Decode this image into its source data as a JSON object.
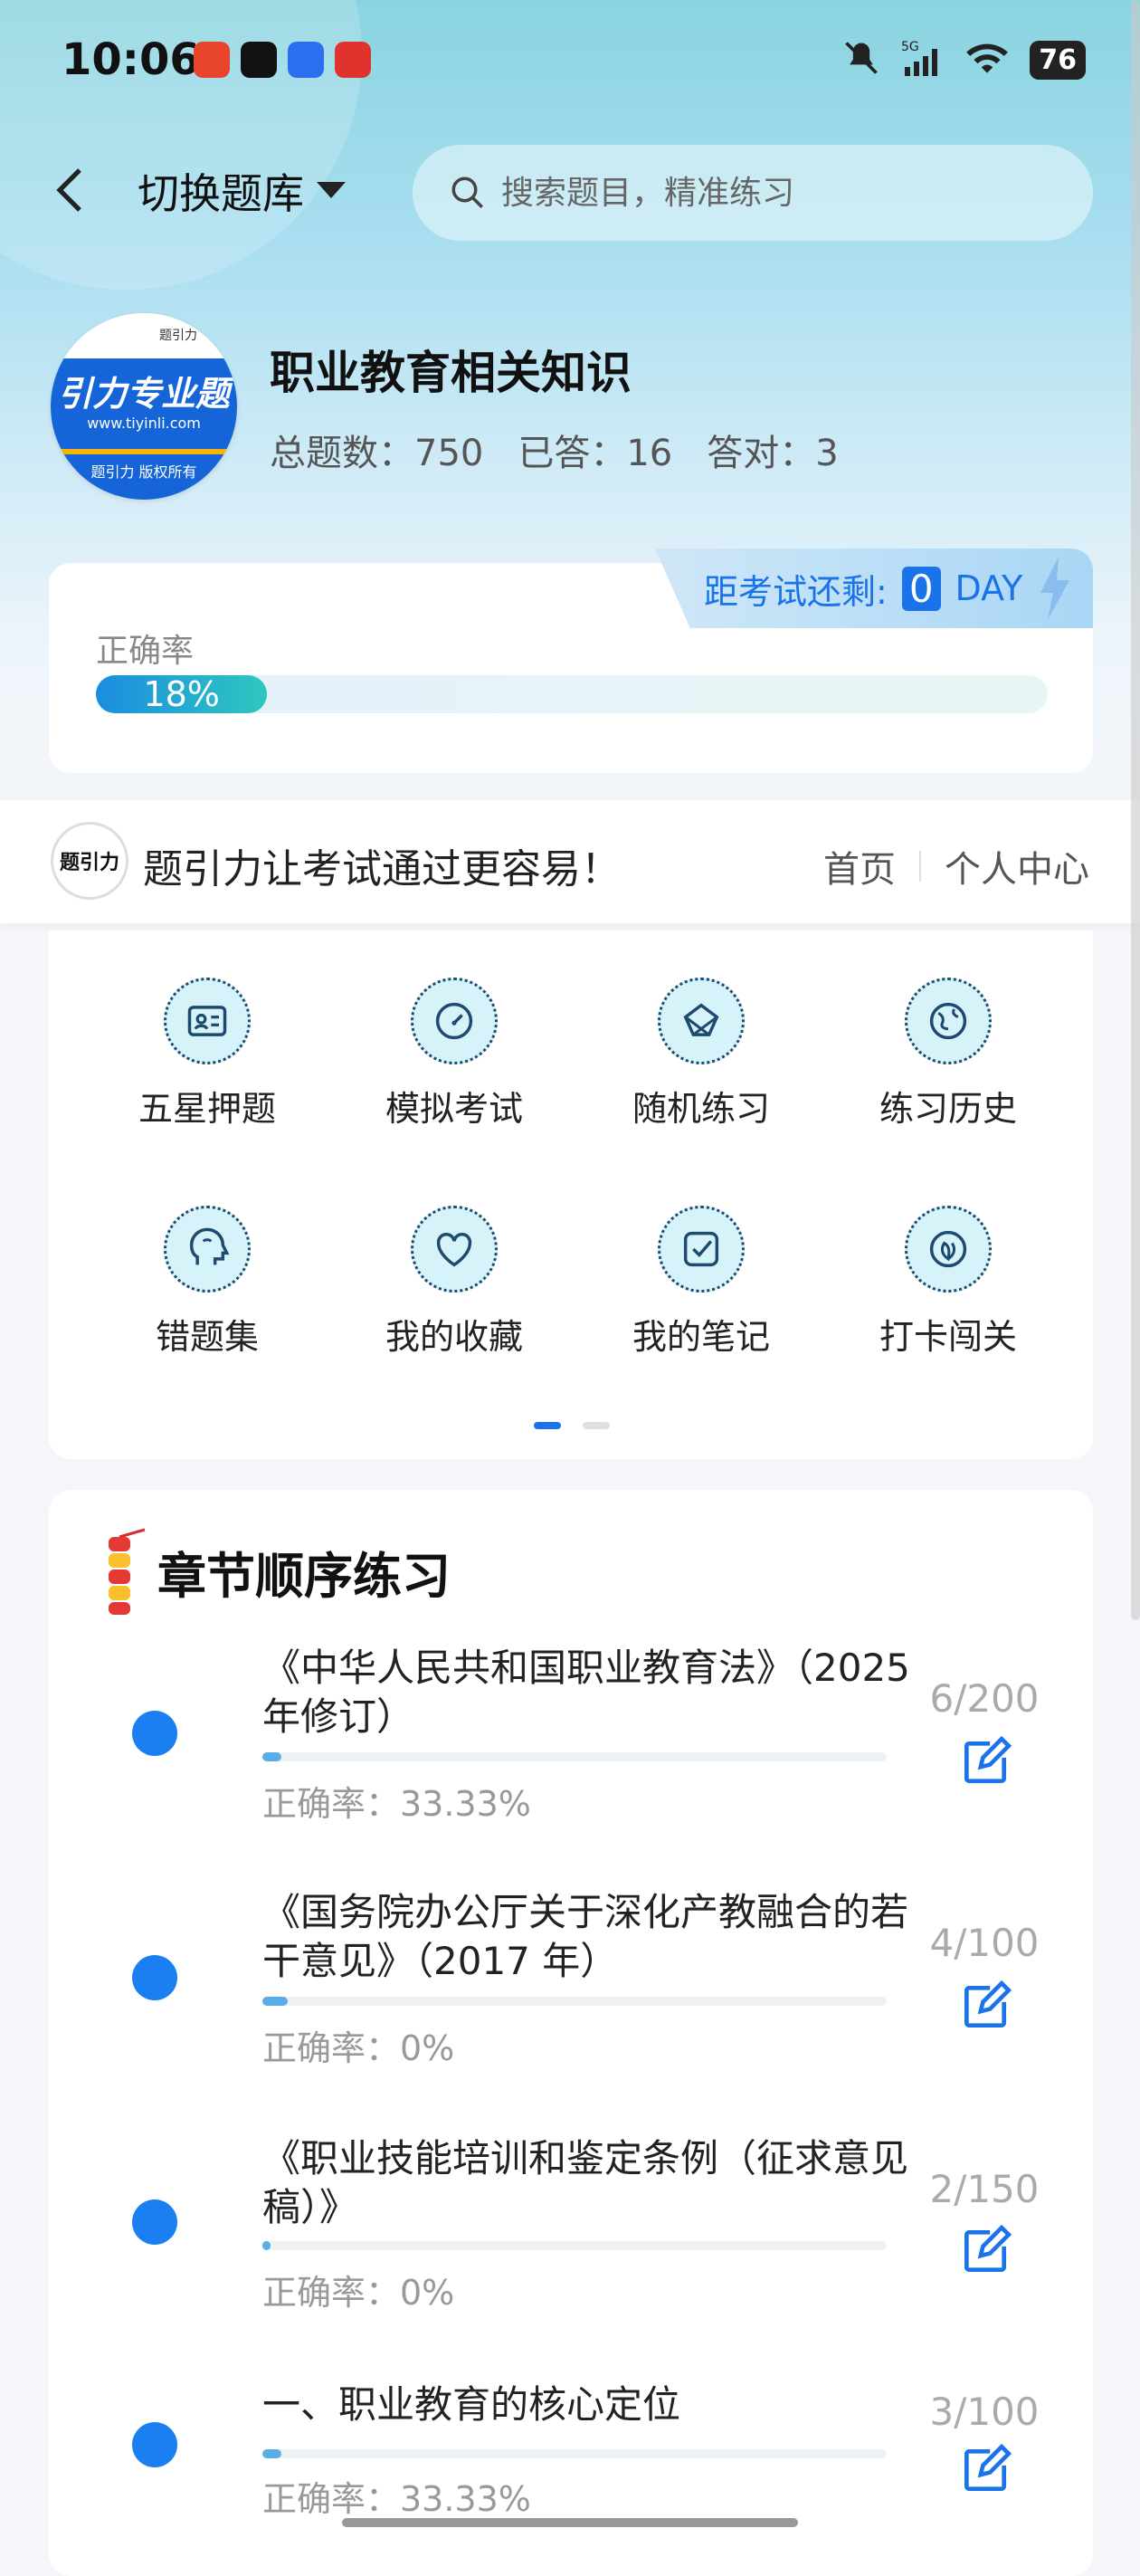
{
  "status_bar": {
    "time": "10:06",
    "battery": "76",
    "network": "5G"
  },
  "header": {
    "switch_label": "切换题库",
    "search_placeholder": "搜索题目，精准练习"
  },
  "bank": {
    "logo_text": "引力专业题",
    "logo_url": "www.tiyinli.com",
    "logo_copyright": "题引力 版权所有",
    "logo_mini": "题引力",
    "title": "职业教育相关知识",
    "stats": {
      "total": "总题数：750",
      "answered": "已答：16",
      "correct": "答对：3"
    }
  },
  "accuracy": {
    "label": "正确率",
    "percent_text": "18%",
    "percent": 18,
    "countdown_label": "距考试还剩:",
    "countdown_days": "0",
    "countdown_unit": "DAY"
  },
  "brand": {
    "logo": "题引力",
    "slogan": "题引力让考试通过更容易！",
    "nav_home": "首页",
    "nav_profile": "个人中心"
  },
  "functions": [
    {
      "label": "五星押题",
      "icon": "id-card-icon"
    },
    {
      "label": "模拟考试",
      "icon": "gauge-icon"
    },
    {
      "label": "随机练习",
      "icon": "network-icon"
    },
    {
      "label": "练习历史",
      "icon": "globe-icon"
    },
    {
      "label": "错题集",
      "icon": "head-icon"
    },
    {
      "label": "我的收藏",
      "icon": "heart-icon"
    },
    {
      "label": "我的笔记",
      "icon": "checkbox-icon"
    },
    {
      "label": "打卡闯关",
      "icon": "leaf-icon"
    }
  ],
  "chapters": {
    "title": "章节顺序练习",
    "items": [
      {
        "title": "《中华人民共和国职业教育法》（2025 年修订）",
        "accuracy": "正确率：33.33%",
        "count": "6/200",
        "progress": 0.03
      },
      {
        "title": "《国务院办公厅关于深化产教融合的若干意见》（2017 年）",
        "accuracy": "正确率：0%",
        "count": "4/100",
        "progress": 0.04
      },
      {
        "title": "《职业技能培训和鉴定条例（征求意见稿）》",
        "accuracy": "正确率：0%",
        "count": "2/150",
        "progress": 0.013
      },
      {
        "title": "一、职业教育的核心定位",
        "accuracy": "正确率：33.33%",
        "count": "3/100",
        "progress": 0.03
      }
    ]
  },
  "colors": {
    "accent": "#1a73e8",
    "chapter_dot": "#1a7ff0",
    "progress_start": "#1a8de0",
    "progress_end": "#2fc7bf"
  }
}
